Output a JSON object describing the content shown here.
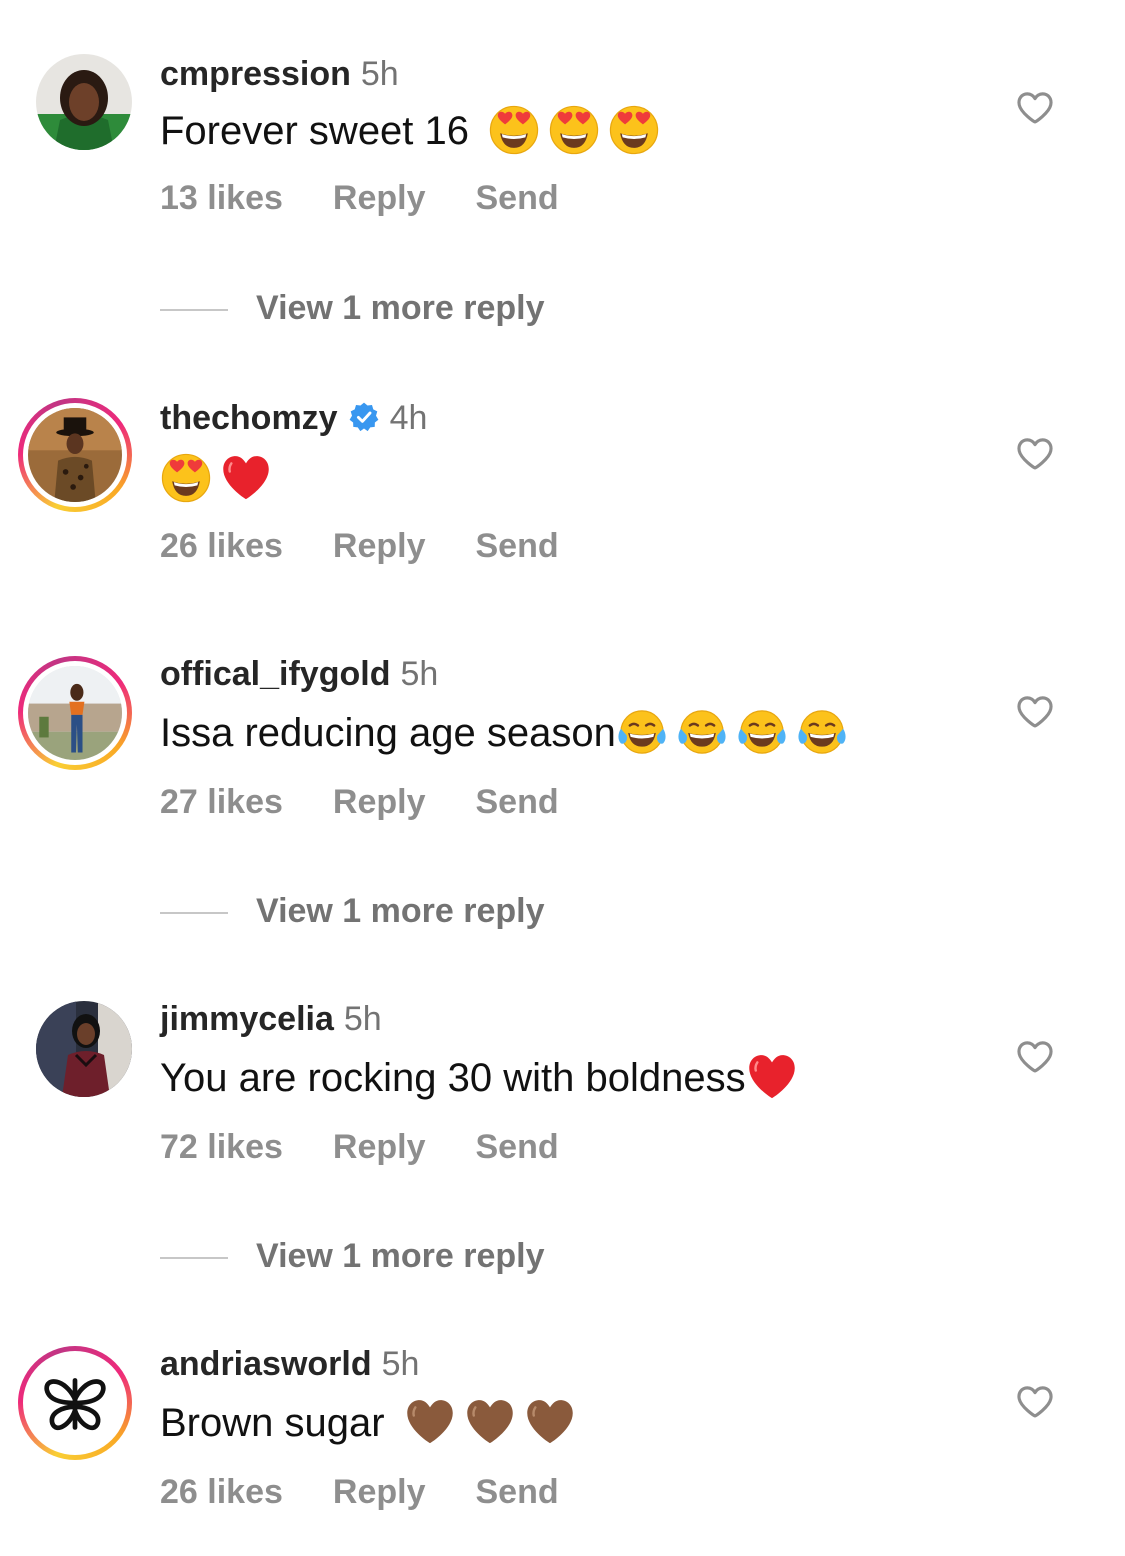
{
  "comments": [
    {
      "username": "cmpression",
      "time": "5h",
      "verified": false,
      "text": "Forever sweet 16",
      "emojis": [
        "heart-eyes-emoji",
        "heart-eyes-emoji",
        "heart-eyes-emoji"
      ],
      "likes": "13 likes",
      "reply_label": "Reply",
      "send_label": "Send",
      "view_more": "View 1 more reply"
    },
    {
      "username": "thechomzy",
      "time": "4h",
      "verified": true,
      "text": "",
      "emojis": [
        "heart-eyes-emoji",
        "red-heart-emoji"
      ],
      "likes": "26 likes",
      "reply_label": "Reply",
      "send_label": "Send"
    },
    {
      "username": "offical_ifygold",
      "time": "5h",
      "verified": false,
      "text": "Issa reducing age season",
      "emojis": [
        "tears-of-joy-emoji",
        "tears-of-joy-emoji",
        "tears-of-joy-emoji",
        "tears-of-joy-emoji"
      ],
      "likes": "27 likes",
      "reply_label": "Reply",
      "send_label": "Send",
      "view_more": "View 1 more reply"
    },
    {
      "username": "jimmycelia",
      "time": "5h",
      "verified": false,
      "text": "You are rocking 30 with boldness",
      "emojis": [
        "red-heart-emoji"
      ],
      "likes": "72 likes",
      "reply_label": "Reply",
      "send_label": "Send",
      "view_more": "View 1 more reply"
    },
    {
      "username": "andriasworld",
      "time": "5h",
      "verified": false,
      "text": "Brown sugar",
      "emojis": [
        "brown-heart-emoji",
        "brown-heart-emoji",
        "brown-heart-emoji"
      ],
      "likes": "26 likes",
      "reply_label": "Reply",
      "send_label": "Send"
    }
  ],
  "colors": {
    "username": "#262626",
    "meta_gray": "#737373",
    "action_gray": "#8e8e8e",
    "verified_blue": "#3897f0",
    "story_ring_start": "#f9ce34",
    "story_ring_mid": "#ee2a7b",
    "story_ring_end": "#c13584"
  }
}
